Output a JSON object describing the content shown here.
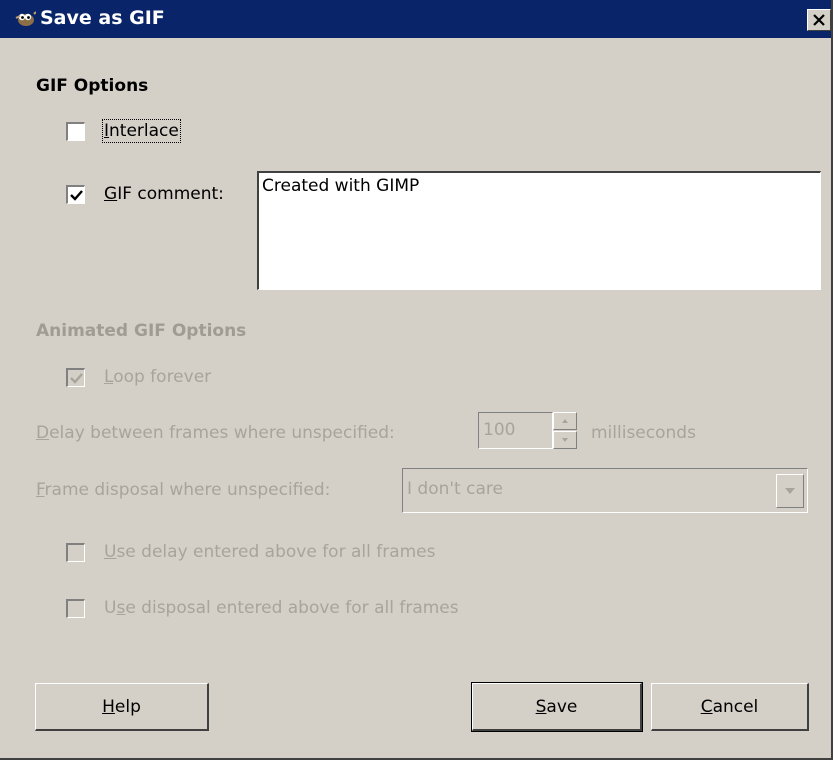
{
  "window": {
    "title": "Save as GIF",
    "app_icon": "gimp-wilber-icon",
    "close_icon": "close-x-icon"
  },
  "gif_options": {
    "heading": "GIF Options",
    "interlace": {
      "mnemonic": "I",
      "rest": "nterlace",
      "checked": false
    },
    "gif_comment": {
      "mnemonic": "G",
      "rest": "IF comment:",
      "checked": true
    },
    "comment_value": "Created with GIMP"
  },
  "animated_options": {
    "heading": "Animated GIF Options",
    "loop_forever": {
      "mnemonic": "L",
      "rest": "oop forever",
      "checked": true,
      "enabled": false
    },
    "delay": {
      "mnemonic": "D",
      "rest": "elay between frames where unspecified:",
      "value": "100",
      "unit": "milliseconds"
    },
    "disposal": {
      "mnemonic": "F",
      "rest": "rame disposal where unspecified:",
      "selected": "I don't care"
    },
    "use_delay": {
      "mnemonic": "U",
      "rest": "se delay entered above for all frames",
      "checked": false,
      "enabled": false
    },
    "use_disposal": {
      "pre": "U",
      "mnemonic": "s",
      "rest": "e disposal entered above for all frames",
      "checked": false,
      "enabled": false
    }
  },
  "buttons": {
    "help": {
      "mnemonic": "H",
      "rest": "elp"
    },
    "save": {
      "mnemonic": "S",
      "rest": "ave"
    },
    "cancel": {
      "mnemonic": "C",
      "rest": "ancel"
    }
  },
  "colors": {
    "titlebar": "#0a246a",
    "face": "#d4d0c8",
    "disabled_text": "#a8a49c"
  }
}
